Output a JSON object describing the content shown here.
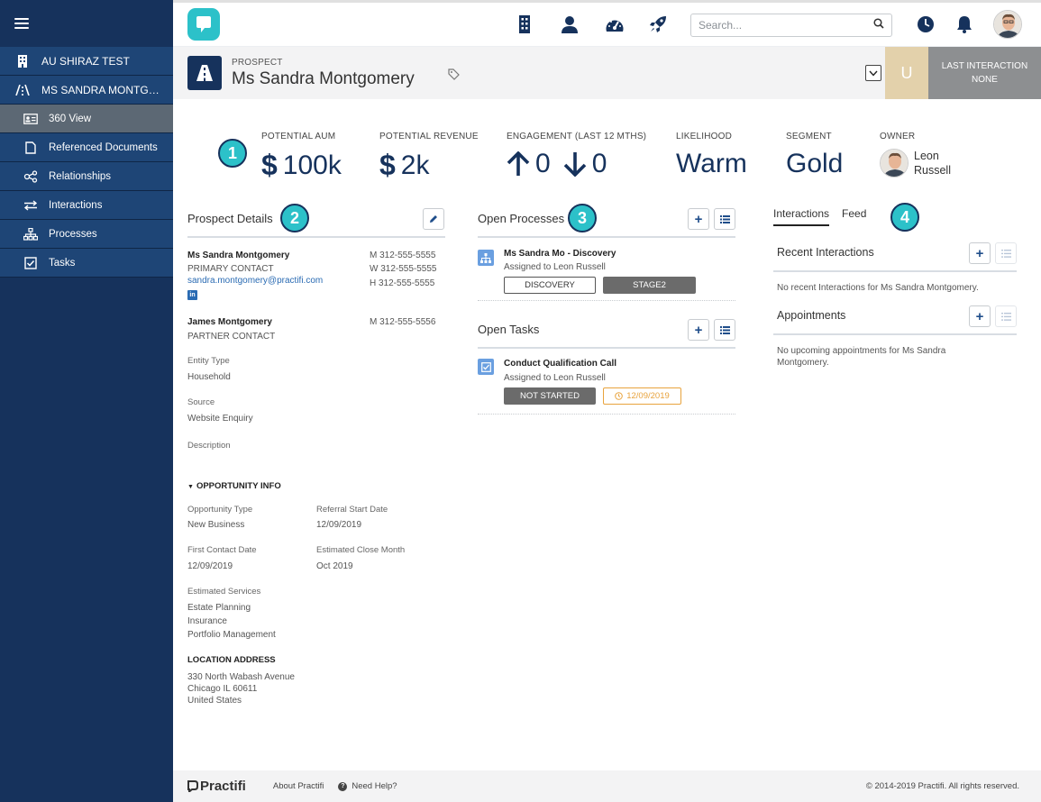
{
  "sidebar": {
    "items": [
      {
        "label": "AU SHIRAZ TEST",
        "icon": "building-icon"
      },
      {
        "label": "MS SANDRA MONTGOM...",
        "icon": "road-icon"
      }
    ],
    "subitems": [
      {
        "label": "360 View",
        "icon": "contact-card-icon",
        "active": true
      },
      {
        "label": "Referenced Documents",
        "icon": "document-icon"
      },
      {
        "label": "Relationships",
        "icon": "relationship-icon"
      },
      {
        "label": "Interactions",
        "icon": "swap-arrows-icon"
      },
      {
        "label": "Processes",
        "icon": "hierarchy-icon"
      },
      {
        "label": "Tasks",
        "icon": "checkbox-icon"
      }
    ]
  },
  "topbar": {
    "search_placeholder": "Search..."
  },
  "record": {
    "type": "PROSPECT",
    "name": "Ms Sandra Montgomery",
    "avatar_letter": "U",
    "last_interaction_label": "LAST INTERACTION",
    "last_interaction_value": "NONE"
  },
  "kpis": {
    "aum": {
      "label": "POTENTIAL AUM",
      "currency": "$",
      "value": "100k"
    },
    "revenue": {
      "label": "POTENTIAL REVENUE",
      "currency": "$",
      "value": "2k"
    },
    "engagement": {
      "label": "ENGAGEMENT (LAST 12 MTHS)",
      "up": "0",
      "down": "0"
    },
    "likelihood": {
      "label": "LIKELIHOOD",
      "value": "Warm"
    },
    "segment": {
      "label": "SEGMENT",
      "value": "Gold"
    },
    "owner": {
      "label": "OWNER",
      "first": "Leon",
      "last": "Russell"
    }
  },
  "badges": [
    "1",
    "2",
    "3",
    "4"
  ],
  "details": {
    "title": "Prospect Details",
    "primary": {
      "name": "Ms Sandra Montgomery",
      "role": "PRIMARY CONTACT",
      "email": "sandra.montgomery@practifi.com",
      "phones": [
        "M 312-555-5555",
        "W 312-555-5555",
        "H 312-555-5555"
      ]
    },
    "partner": {
      "name": "James Montgomery",
      "role": "PARTNER CONTACT",
      "phone": "M 312-555-5556"
    },
    "entity_type_label": "Entity Type",
    "entity_type": "Household",
    "source_label": "Source",
    "source": "Website Enquiry",
    "description_label": "Description",
    "opportunity_header": "OPPORTUNITY INFO",
    "opportunity_type_label": "Opportunity Type",
    "opportunity_type": "New Business",
    "referral_start_label": "Referral Start Date",
    "referral_start": "12/09/2019",
    "first_contact_label": "First Contact Date",
    "first_contact": "12/09/2019",
    "est_close_label": "Estimated Close Month",
    "est_close": "Oct 2019",
    "services_label": "Estimated Services",
    "services": [
      "Estate Planning",
      "Insurance",
      "Portfolio Management"
    ],
    "location_label": "LOCATION ADDRESS",
    "address": [
      "330 North Wabash Avenue",
      "Chicago IL 60611",
      "United States"
    ]
  },
  "processes": {
    "title": "Open Processes",
    "item_title": "Ms Sandra Mo - Discovery",
    "item_assigned": "Assigned to Leon Russell",
    "stage_outline": "DISCOVERY",
    "stage_filled": "STAGE2"
  },
  "tasks": {
    "title": "Open Tasks",
    "item_title": "Conduct Qualification Call",
    "item_assigned": "Assigned to Leon Russell",
    "status": "NOT STARTED",
    "due": "12/09/2019"
  },
  "right": {
    "tab_interactions": "Interactions",
    "tab_feed": "Feed",
    "recent_title": "Recent Interactions",
    "recent_empty": "No recent Interactions for Ms Sandra Montgomery.",
    "appointments_title": "Appointments",
    "appointments_empty_1": "No upcoming appointments for Ms Sandra",
    "appointments_empty_2": "Montgomery."
  },
  "footer": {
    "brand": "Practifi",
    "about": "About Practifi",
    "help": "Need Help?",
    "copyright": "© 2014-2019 Practifi. All rights reserved."
  },
  "colors": {
    "navy": "#16325c",
    "teal": "#2cc1c9",
    "sidebar_active": "#5c6874",
    "due_orange": "#e8a33d"
  }
}
